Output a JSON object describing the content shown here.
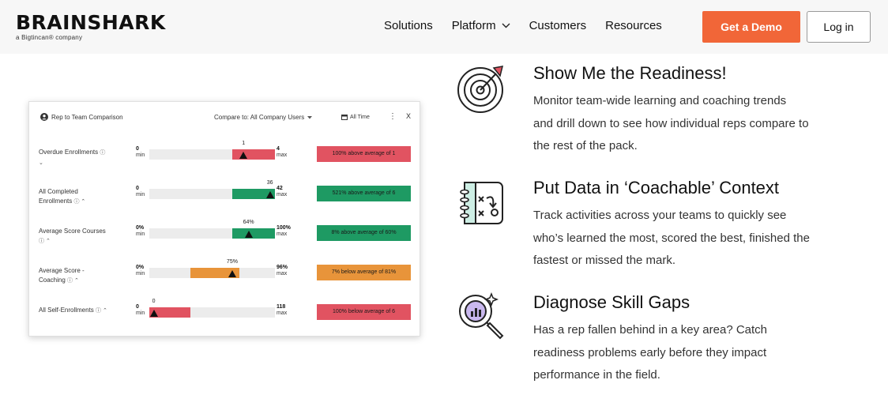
{
  "header": {
    "logo_word": "BRAINSHARK",
    "logo_sub": "a Bigtincan® company",
    "nav": [
      {
        "label": "Solutions"
      },
      {
        "label": "Platform"
      },
      {
        "label": "Customers"
      },
      {
        "label": "Resources"
      }
    ],
    "demo_label": "Get a Demo",
    "login_label": "Log in"
  },
  "card": {
    "title": "Rep to Team Comparison",
    "compare_label": "Compare to: All Company Users",
    "time_label": "All Time",
    "kebab": "⋮",
    "close": "X",
    "rows": [
      {
        "label1": "Overdue Enrollments",
        "label2": "",
        "icon1": "ⓘ",
        "icon2": "⌄",
        "min": "0",
        "min_label": "min",
        "max": "4",
        "max_label": "max",
        "value_label": "1",
        "fill_from": 0.66,
        "fill_to": 1.0,
        "marker": 0.75,
        "badge": "100% above average of 1",
        "status": "above",
        "color": "#e15361"
      },
      {
        "label1": "All Completed",
        "label2": "Enrollments",
        "icon1": "",
        "icon2": "ⓘ ⌃",
        "min": "0",
        "min_label": "min",
        "max": "42",
        "max_label": "max",
        "value_label": "36",
        "fill_from": 0.66,
        "fill_to": 1.0,
        "marker": 0.96,
        "badge": "521% above average of 6",
        "status": "above",
        "color": "#1e9a63"
      },
      {
        "label1": "Average Score Courses",
        "label2": "",
        "icon1": "",
        "icon2": "ⓘ ⌃",
        "min": "0%",
        "min_label": "min",
        "max": "100%",
        "max_label": "max",
        "value_label": "64%",
        "fill_from": 0.66,
        "fill_to": 1.0,
        "marker": 0.79,
        "badge": "8% above average of 60%",
        "status": "above",
        "color": "#1e9a63"
      },
      {
        "label1": "Average Score -",
        "label2": "Coaching",
        "icon1": "",
        "icon2": "ⓘ ⌃",
        "min": "0%",
        "min_label": "min",
        "max": "96%",
        "max_label": "max",
        "value_label": "75%",
        "fill_from": 0.33,
        "fill_to": 0.72,
        "marker": 0.66,
        "badge": "7% below average of 81%",
        "status": "below",
        "color": "#e8943a"
      },
      {
        "label1": "All Self-Enrollments",
        "label2": "",
        "icon1": "ⓘ ⌃",
        "icon2": "",
        "min": "0",
        "min_label": "min",
        "max": "118",
        "max_label": "max",
        "value_label": "0",
        "fill_from": 0.0,
        "fill_to": 0.33,
        "marker": 0.035,
        "badge": "100% below average of 6",
        "status": "below",
        "color": "#e15361"
      }
    ]
  },
  "features": [
    {
      "title": "Show Me the Readiness!",
      "lines": [
        "Monitor team-wide learning and coaching trends",
        "and drill down to see how individual reps compare to",
        "the rest of the pack."
      ],
      "icon": "target-icon"
    },
    {
      "title": "Put Data in ‘Coachable’ Context",
      "lines": [
        "Track activities across your teams to quickly see",
        "who’s learned the most, scored the best, finished the",
        "fastest or missed the mark."
      ],
      "icon": "playbook-icon"
    },
    {
      "title": "Diagnose Skill Gaps",
      "lines": [
        "Has a rep fallen behind in a key area? Catch",
        "readiness problems early before they impact",
        "performance in the field."
      ],
      "icon": "magnifier-chart-icon"
    }
  ],
  "colors": {
    "accent": "#f16638",
    "red": "#e15361",
    "green": "#1e9a63",
    "orange": "#e8943a",
    "track": "#ececec"
  }
}
